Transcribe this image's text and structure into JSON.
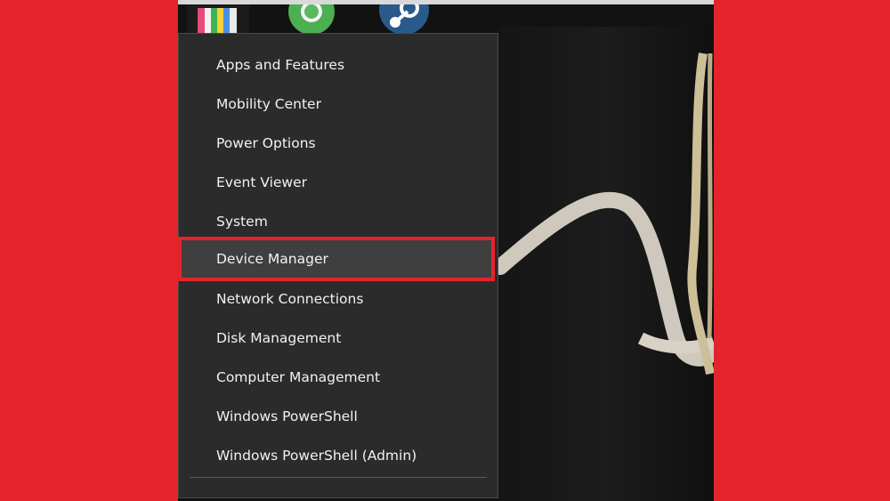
{
  "colors": {
    "background": "#e4242b",
    "menu_bg": "#2b2b2b",
    "menu_text": "#f2f2f2",
    "highlight_border": "#e4242b",
    "highlight_bg": "#3f3f3f"
  },
  "desktop": {
    "icons": [
      "colorful-app-icon",
      "chrome-icon",
      "steam-icon"
    ]
  },
  "menu": {
    "items": [
      {
        "label": "Apps and Features",
        "icon": "none",
        "highlighted": false
      },
      {
        "label": "Mobility Center",
        "icon": "none",
        "highlighted": false
      },
      {
        "label": "Power Options",
        "icon": "none",
        "highlighted": false
      },
      {
        "label": "Event Viewer",
        "icon": "none",
        "highlighted": false
      },
      {
        "label": "System",
        "icon": "none",
        "highlighted": false
      },
      {
        "label": "Device Manager",
        "icon": "none",
        "highlighted": true
      },
      {
        "label": "Network Connections",
        "icon": "none",
        "highlighted": false
      },
      {
        "label": "Disk Management",
        "icon": "none",
        "highlighted": false
      },
      {
        "label": "Computer Management",
        "icon": "none",
        "highlighted": false
      },
      {
        "label": "Windows PowerShell",
        "icon": "none",
        "highlighted": false
      },
      {
        "label": "Windows PowerShell (Admin)",
        "icon": "none",
        "highlighted": false
      }
    ]
  }
}
